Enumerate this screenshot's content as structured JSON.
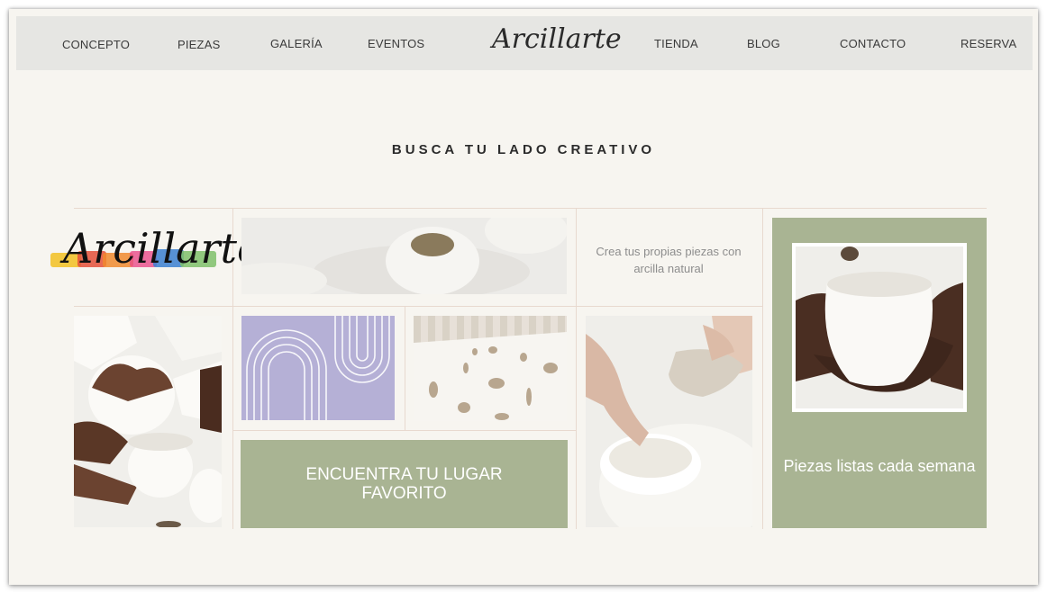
{
  "nav": {
    "items": [
      "CONCEPTO",
      "PIEZAS",
      "GALERÍA",
      "EVENTOS",
      "TIENDA",
      "BLOG",
      "CONTACTO",
      "RESERVA"
    ],
    "logo": "Arcillarte"
  },
  "hero": {
    "headline": "BUSCA TU LADO CREATIVO"
  },
  "grid": {
    "brand_logo": "Arcillarte",
    "tagline": "Crea tus propias piezas con arcilla natural",
    "cta_place": "ENCUENTRA TU LUGAR FAVORITO",
    "cta_pieces": "Piezas listas cada semana"
  },
  "colors": {
    "page_bg": "#f7f5f0",
    "nav_bg": "#e6e6e3",
    "sage": "#a9b493",
    "lavender": "#b5b0d6",
    "divider": "#e8d9cf"
  }
}
